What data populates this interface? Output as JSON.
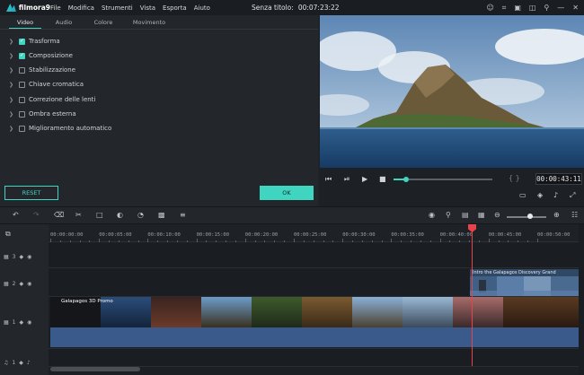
{
  "app": {
    "logo_text": "filmora9",
    "menu": [
      "File",
      "Modifica",
      "Strumenti",
      "Vista",
      "Esporta",
      "Aiuto"
    ],
    "title_label": "Senza titolo:",
    "title_time": "00:07:23:22",
    "window_icons": [
      "user-icon",
      "cart-icon",
      "gift-icon",
      "save-icon",
      "mic-icon",
      "minimize-icon",
      "close-icon"
    ]
  },
  "editor": {
    "tabs": [
      "Video",
      "Audio",
      "Colore",
      "Movimento"
    ],
    "active_tab": "Video",
    "properties": [
      {
        "label": "Trasforma",
        "checked": true
      },
      {
        "label": "Composizione",
        "checked": true
      },
      {
        "label": "Stabilizzazione",
        "checked": false
      },
      {
        "label": "Chiave cromatica",
        "checked": false
      },
      {
        "label": "Correzione delle lenti",
        "checked": false
      },
      {
        "label": "Ombra esterna",
        "checked": false
      },
      {
        "label": "Miglioramento automatico",
        "checked": false
      }
    ],
    "reset_label": "RESET",
    "ok_label": "OK"
  },
  "preview": {
    "timecode": "00:00:43:11",
    "progress": 0.13,
    "brackets": "{  }"
  },
  "timeline": {
    "ruler_labels": [
      "00:00:00:00",
      "00:00:05:00",
      "00:00:10:00",
      "00:00:15:00",
      "00:00:20:00",
      "00:00:25:00",
      "00:00:30:00",
      "00:00:35:00",
      "00:00:40:00",
      "00:00:45:00",
      "00:00:50:00"
    ],
    "tracks": [
      {
        "number": "3",
        "type": "video"
      },
      {
        "number": "2",
        "type": "video"
      },
      {
        "number": "1",
        "type": "video"
      },
      {
        "number": "1",
        "type": "audio"
      }
    ],
    "main_clip_label": "Galapagos 3D Promo",
    "pip_clip_label": "Intro the Galapagos Discovery Grand",
    "zoom_level": 0.6,
    "colors": {
      "accent": "#3fd5c0",
      "playhead": "#e8434a",
      "audio_bar": "#3b5a8c"
    }
  }
}
